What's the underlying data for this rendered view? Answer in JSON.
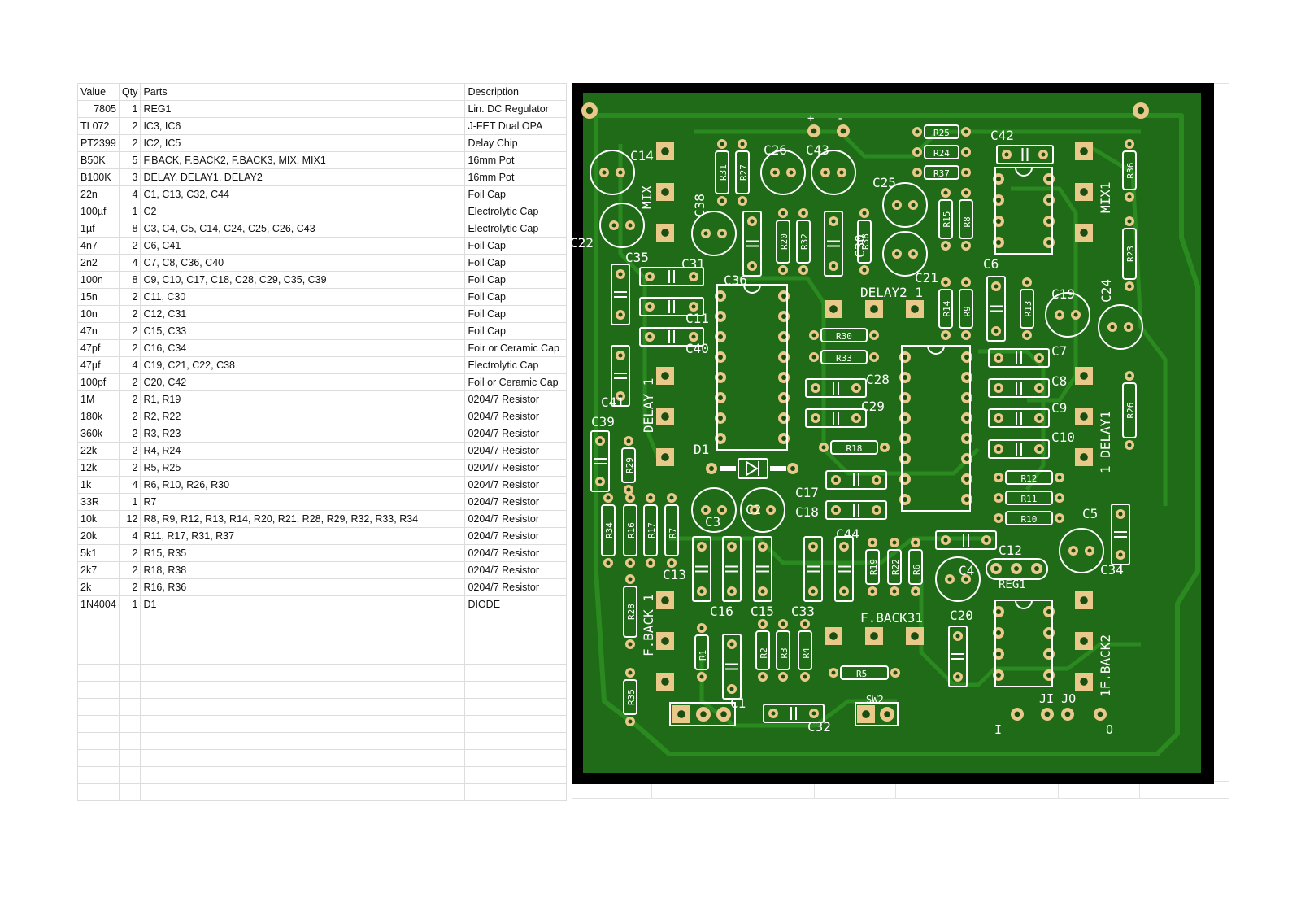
{
  "bom": {
    "columns": [
      "Value",
      "Qty",
      "Parts",
      "Description"
    ],
    "rows": [
      [
        "7805",
        "1",
        "REG1",
        "Lin. DC Regulator"
      ],
      [
        "TL072",
        "2",
        "IC3, IC6",
        "J-FET Dual OPA"
      ],
      [
        "PT2399",
        "2",
        "IC2, IC5",
        "Delay Chip"
      ],
      [
        "B50K",
        "5",
        "F.BACK, F.BACK2, F.BACK3, MIX, MIX1",
        "16mm Pot"
      ],
      [
        "B100K",
        "3",
        "DELAY, DELAY1, DELAY2",
        "16mm Pot"
      ],
      [
        "22n",
        "4",
        "C1, C13, C32, C44",
        "Foil Cap"
      ],
      [
        "100µf",
        "1",
        "C2",
        "Electrolytic Cap"
      ],
      [
        "1µf",
        "8",
        "C3, C4, C5, C14, C24, C25, C26, C43",
        "Electrolytic Cap"
      ],
      [
        "4n7",
        "2",
        "C6, C41",
        "Foil Cap"
      ],
      [
        "2n2",
        "4",
        "C7, C8, C36, C40",
        "Foil Cap"
      ],
      [
        "100n",
        "8",
        "C9, C10, C17, C18, C28, C29, C35, C39",
        "Foil Cap"
      ],
      [
        "15n",
        "2",
        "C11, C30",
        "Foil Cap"
      ],
      [
        "10n",
        "2",
        "C12, C31",
        "Foil Cap"
      ],
      [
        "47n",
        "2",
        "C15, C33",
        "Foil Cap"
      ],
      [
        "47pf",
        "2",
        "C16, C34",
        "Foir or Ceramic Cap"
      ],
      [
        "47µf",
        "4",
        "C19, C21, C22, C38",
        "Electrolytic Cap"
      ],
      [
        "100pf",
        "2",
        "C20, C42",
        "Foil or Ceramic Cap"
      ],
      [
        "1M",
        "2",
        "R1, R19",
        "0204/7 Resistor"
      ],
      [
        "180k",
        "2",
        "R2, R22",
        "0204/7 Resistor"
      ],
      [
        "360k",
        "2",
        "R3, R23",
        "0204/7 Resistor"
      ],
      [
        "22k",
        "2",
        "R4, R24",
        "0204/7 Resistor"
      ],
      [
        "12k",
        "2",
        "R5, R25",
        "0204/7 Resistor"
      ],
      [
        "1k",
        "4",
        "R6, R10, R26, R30",
        "0204/7 Resistor"
      ],
      [
        "33R",
        "1",
        "R7",
        "0204/7 Resistor"
      ],
      [
        "10k",
        "12",
        "R8, R9, R12, R13, R14, R20, R21, R28, R29, R32, R33, R34",
        "0204/7 Resistor"
      ],
      [
        "20k",
        "4",
        "R11, R17, R31, R37",
        "0204/7 Resistor"
      ],
      [
        "5k1",
        "2",
        "R15, R35",
        "0204/7 Resistor"
      ],
      [
        "2k7",
        "2",
        "R18, R38",
        "0204/7 Resistor"
      ],
      [
        "2k",
        "2",
        "R16, R36",
        "0204/7 Resistor"
      ],
      [
        "1N4004",
        "1",
        "D1",
        "DIODE"
      ]
    ],
    "empty_rows": 11
  },
  "pcb": {
    "colors": {
      "frame": "#000000",
      "board": "#1f6b17",
      "copper": "#2a8a20",
      "pad": "#e8c98a",
      "silk": "#ffffff"
    },
    "labels": {
      "mix": "MIX",
      "mix1": "MIX1",
      "delay_1": "DELAY 1",
      "delay1": "1 DELAY1",
      "delay2": "DELAY2 1",
      "fback_1": "F.BACK 1",
      "fback2": "1F.BACK2",
      "fback3": "F.BACK31",
      "reg1": "REG1",
      "d1": "D1",
      "sw2": "SW2",
      "j": "JI JO",
      "in": "I",
      "out": "O",
      "plus": "+",
      "minus": "-",
      "c14": "C14",
      "c26": "C26",
      "c43": "C43",
      "c25": "C25",
      "c42": "C42",
      "c22": "C22",
      "c38": "C38",
      "c35": "C35",
      "c31": "C31",
      "c36": "C36",
      "c30": "C30",
      "c21": "C21",
      "c6": "C6",
      "c19": "C19",
      "c24": "C24",
      "c11": "C11",
      "c40": "C40",
      "c7": "C7",
      "c28": "C28",
      "c8": "C8",
      "c29": "C29",
      "c9": "C9",
      "c10": "C10",
      "c41": "C41",
      "c39": "C39",
      "c17": "C17",
      "c18": "C18",
      "c3": "C3",
      "c2": "C2",
      "c5": "C5",
      "c44": "C44",
      "c12": "C12",
      "c4": "C4",
      "c34": "C34",
      "c13": "C13",
      "c16": "C16",
      "c15": "C15",
      "c33": "C33",
      "c20": "C20",
      "c1": "C1",
      "c32": "C32",
      "r25": "R25",
      "r24": "R24",
      "r37": "R37",
      "r36": "R36",
      "r31": "R31",
      "r27": "R27",
      "r20": "R20",
      "r32": "R32",
      "r38": "R38",
      "r15": "R15",
      "r8": "R8",
      "r23": "R23",
      "r14": "R14",
      "r9": "R9",
      "r13": "R13",
      "r30": "R30",
      "r33": "R33",
      "r18": "R18",
      "r26": "R26",
      "r29": "R29",
      "r12": "R12",
      "r11": "R11",
      "r10": "R10",
      "r34": "R34",
      "r16": "R16",
      "r17": "R17",
      "r7": "R7",
      "r19": "R19",
      "r22": "R22",
      "r6": "R6",
      "r28": "R28",
      "r1": "R1",
      "r2": "R2",
      "r3": "R3",
      "r4": "R4",
      "r5": "R5",
      "r35": "R35"
    }
  }
}
